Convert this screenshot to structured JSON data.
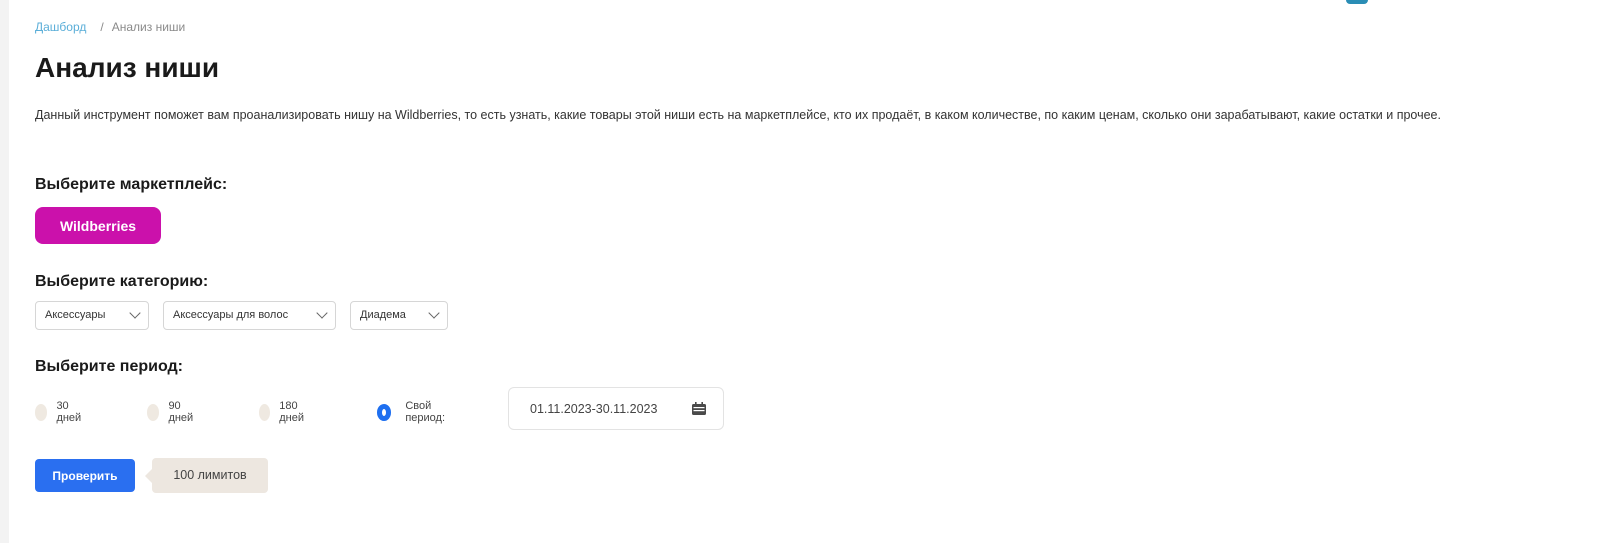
{
  "breadcrumb": {
    "home": "Дашборд",
    "separator": "/",
    "current": "Анализ ниши"
  },
  "page": {
    "title": "Анализ ниши",
    "description": "Данный инструмент поможет вам проанализировать нишу на Wildberries, то есть узнать, какие товары этой ниши есть на маркетплейсе, кто их продаёт, в каком количестве, по каким ценам, сколько они зарабатывают, какие остатки и прочее."
  },
  "marketplace": {
    "label": "Выберите маркетплейс:",
    "selected": "Wildberries",
    "color": "#cb11ab"
  },
  "category": {
    "label": "Выберите категорию:",
    "selects": [
      "Аксессуары",
      "Аксессуары для волос",
      "Диадема"
    ]
  },
  "period": {
    "label": "Выберите период:",
    "options": [
      "30 дней",
      "90 дней",
      "180 дней",
      "Свой период:"
    ],
    "selected_index": 3,
    "custom_range": "01.11.2023-30.11.2023"
  },
  "actions": {
    "check_label": "Проверить",
    "limits_text": "100 лимитов",
    "accent": "#2a6ff0"
  }
}
